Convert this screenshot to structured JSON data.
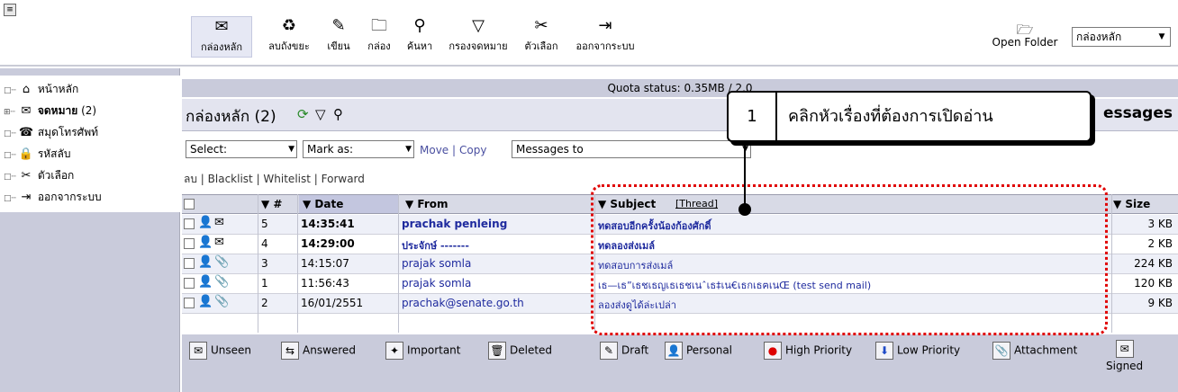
{
  "toolbar": {
    "buttons": [
      {
        "label": "กล่องหลัก",
        "icon": "inbox-envelope-icon",
        "glyph": "✉"
      },
      {
        "label": "ลบถังขยะ",
        "icon": "empty-trash-icon",
        "glyph": "♻"
      },
      {
        "label": "เขียน",
        "icon": "compose-icon",
        "glyph": "✎"
      },
      {
        "label": "กล่อง",
        "icon": "folders-icon",
        "glyph": "🗀"
      },
      {
        "label": "ค้นหา",
        "icon": "search-icon",
        "glyph": "⚲"
      },
      {
        "label": "กรองจดหมาย",
        "icon": "filter-icon",
        "glyph": "▽"
      },
      {
        "label": "ตัวเลือก",
        "icon": "options-tools-icon",
        "glyph": "✂"
      },
      {
        "label": "ออกจากระบบ",
        "icon": "logout-icon",
        "glyph": "⇥"
      }
    ],
    "open_folder_label": "Open Folder",
    "folder_select_value": "กล่องหลัก"
  },
  "sidebar": {
    "items": [
      {
        "label": "หน้าหลัก",
        "icon": "home-icon",
        "glyph": "⌂",
        "count": "",
        "bold": false
      },
      {
        "label": "จดหมาย",
        "icon": "mail-folder-icon",
        "glyph": "✉",
        "count": "(2)",
        "bold": true
      },
      {
        "label": "สมุดโทรศัพท์",
        "icon": "addressbook-icon",
        "glyph": "☎",
        "count": "",
        "bold": false
      },
      {
        "label": "รหัสลับ",
        "icon": "lock-icon",
        "glyph": "🔒",
        "count": "",
        "bold": false
      },
      {
        "label": "ตัวเลือก",
        "icon": "options-icon",
        "glyph": "✂",
        "count": "",
        "bold": false
      },
      {
        "label": "ออกจากระบบ",
        "icon": "logout-icon",
        "glyph": "⇥",
        "count": "",
        "bold": false
      }
    ]
  },
  "main": {
    "quota_text": "Quota status: 0.35MB / 2.0",
    "title": "กล่องหลัก (2)",
    "messages_suffix": "essages",
    "select_label": "Select:",
    "markas_label": "Mark as:",
    "move_label": "Move",
    "copy_label": "Copy",
    "messages_to_label": "Messages to",
    "actions": [
      "ลบ",
      "Blacklist",
      "Whitelist",
      "Forward"
    ],
    "columns": {
      "num": "▼ #",
      "date": "▼ Date",
      "from": "▼ From",
      "subject": "▼ Subject",
      "thread": "[Thread]",
      "size": "▼ Size"
    },
    "rows": [
      {
        "num": "5",
        "date": "14:35:41",
        "from": "prachak penleing",
        "subject": "ทดสอบอีกครั้งน้องก้องศักดิ์",
        "size": "3 KB",
        "unread": true,
        "attach": false
      },
      {
        "num": "4",
        "date": "14:29:00",
        "from": "ประจักษ์ -------",
        "subject": "ทดลองส่งเมล์",
        "size": "2 KB",
        "unread": true,
        "attach": false
      },
      {
        "num": "3",
        "date": "14:15:07",
        "from": "prajak somla",
        "subject": "ทดสอบการส่งเมล์",
        "size": "224 KB",
        "unread": false,
        "attach": true
      },
      {
        "num": "1",
        "date": "11:56:43",
        "from": "prajak somla",
        "subject": "เธ—เธ”เธชเธญเธเธชเนˆเธ‡เน€เธกเธฅเนŒ (test send mail)",
        "size": "120 KB",
        "unread": false,
        "attach": true
      },
      {
        "num": "2",
        "date": "16/01/2551",
        "from": "prachak@senate.go.th",
        "subject": "ลองส่งดูได้ล่ะเปล่า",
        "size": "9 KB",
        "unread": false,
        "attach": true
      }
    ]
  },
  "legend": [
    {
      "label": "Unseen",
      "icon": "unseen-icon",
      "glyph": "✉"
    },
    {
      "label": "Answered",
      "icon": "answered-icon",
      "glyph": "⇆"
    },
    {
      "label": "Important",
      "icon": "important-icon",
      "glyph": "✦"
    },
    {
      "label": "Deleted",
      "icon": "deleted-icon",
      "glyph": "🗑"
    },
    {
      "label": "Draft",
      "icon": "draft-icon",
      "glyph": "✎"
    },
    {
      "label": "Personal",
      "icon": "personal-icon",
      "glyph": "👤"
    },
    {
      "label": "High Priority",
      "icon": "high-priority-icon",
      "glyph": "●"
    },
    {
      "label": "Low Priority",
      "icon": "low-priority-icon",
      "glyph": "⬇"
    },
    {
      "label": "Attachment",
      "icon": "attachment-icon",
      "glyph": "📎"
    },
    {
      "label": "Signed",
      "icon": "signed-icon",
      "glyph": "✉"
    }
  ],
  "callout": {
    "number": "1",
    "text": "คลิกหัวเรื่องที่ต้องการเปิดอ่าน"
  },
  "colors": {
    "annotation_red": "#e00000",
    "link_blue": "#1e2a9e",
    "panel": "#c9cbdb"
  }
}
